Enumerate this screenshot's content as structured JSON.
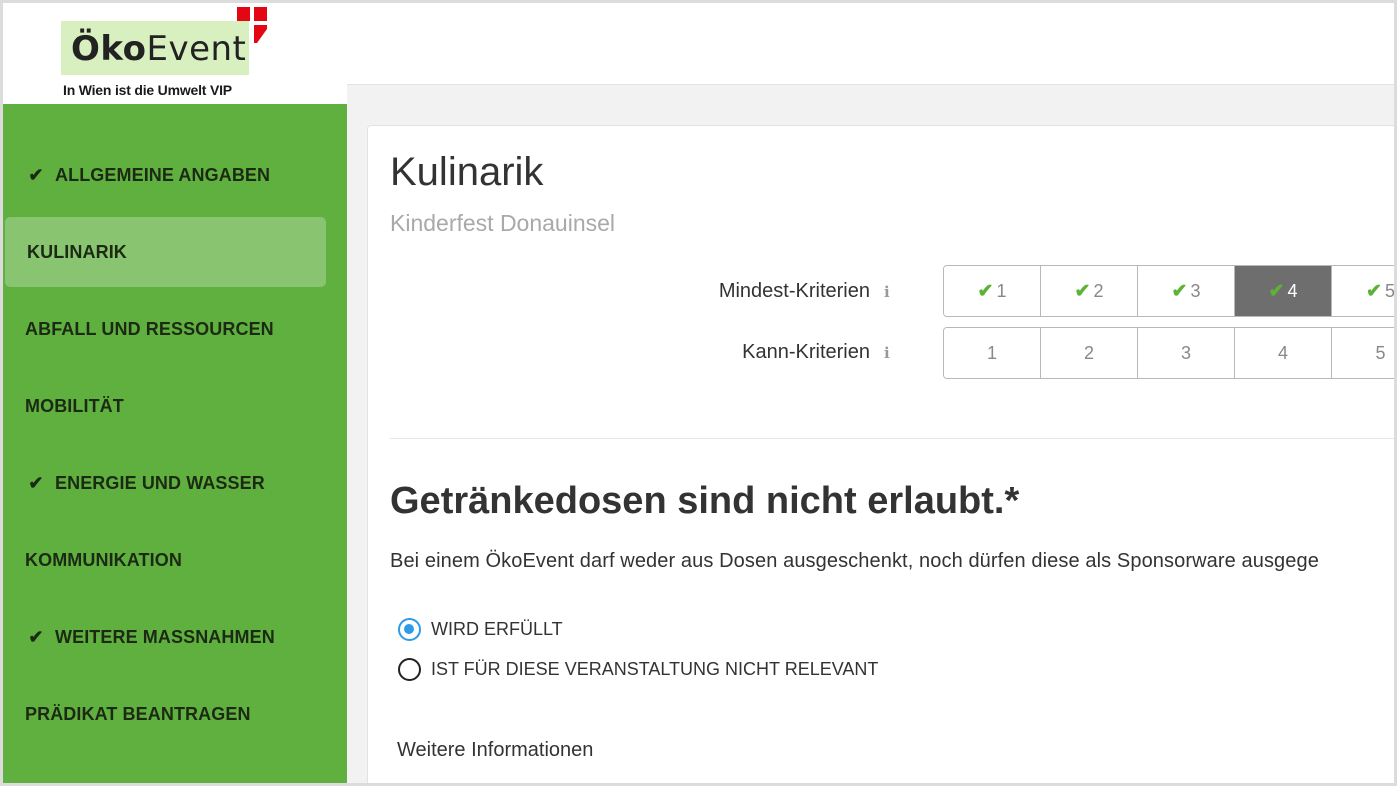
{
  "logo": {
    "brand_bold": "Öko",
    "brand_rest": "Event",
    "tagline": "In Wien ist die Umwelt VIP"
  },
  "sidebar": {
    "items": [
      {
        "label": "ALLGEMEINE ANGABEN",
        "checked": true,
        "active": false
      },
      {
        "label": "KULINARIK",
        "checked": false,
        "active": true
      },
      {
        "label": "ABFALL UND RESSOURCEN",
        "checked": false,
        "active": false
      },
      {
        "label": "MOBILITÄT",
        "checked": false,
        "active": false
      },
      {
        "label": "ENERGIE UND WASSER",
        "checked": true,
        "active": false
      },
      {
        "label": "KOMMUNIKATION",
        "checked": false,
        "active": false
      },
      {
        "label": "WEITERE MASSNAHMEN",
        "checked": true,
        "active": false
      },
      {
        "label": "PRÄDIKAT BEANTRAGEN",
        "checked": false,
        "active": false
      }
    ]
  },
  "main": {
    "title": "Kulinarik",
    "subtitle": "Kinderfest Donauinsel",
    "mindest": {
      "label": "Mindest-Kriterien",
      "info": "i",
      "buttons": [
        {
          "label": "1",
          "checked": true,
          "selected": false
        },
        {
          "label": "2",
          "checked": true,
          "selected": false
        },
        {
          "label": "3",
          "checked": true,
          "selected": false
        },
        {
          "label": "4",
          "checked": true,
          "selected": true
        },
        {
          "label": "5",
          "checked": true,
          "selected": false
        }
      ]
    },
    "kann": {
      "label": "Kann-Kriterien",
      "info": "i",
      "buttons": [
        {
          "label": "1"
        },
        {
          "label": "2"
        },
        {
          "label": "3"
        },
        {
          "label": "4"
        },
        {
          "label": "5"
        }
      ]
    },
    "question": {
      "title": "Getränkedosen sind nicht erlaubt.*",
      "text": "Bei einem ÖkoEvent darf weder aus Dosen ausgeschenkt, noch dürfen diese als Sponsorware ausgege",
      "options": [
        {
          "label": "WIRD ERFÜLLT",
          "checked": true
        },
        {
          "label": "IST FÜR DIESE VERANSTALTUNG NICHT RELEVANT",
          "checked": false
        }
      ]
    },
    "more_info": "Weitere Informationen"
  },
  "colors": {
    "sidebar_green": "#60b040",
    "active_item": "#89c470",
    "check_green": "#5cb338",
    "selected_button": "#6e6e6e",
    "radio_blue": "#2e9be6"
  },
  "icons": {
    "check": "check-icon",
    "info": "info-icon",
    "flag": "vienna-flag-icon"
  }
}
